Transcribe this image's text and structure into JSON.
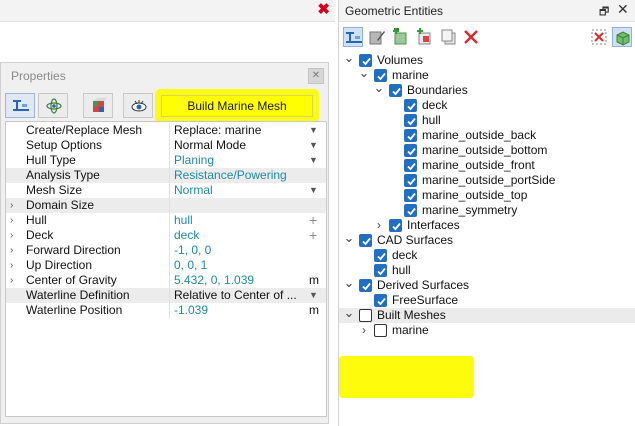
{
  "left_panel": {
    "close_glyph": "✖",
    "properties": {
      "title": "Properties",
      "close_glyph": "✕",
      "tabs": [
        {
          "name": "properties-tab-icon"
        },
        {
          "name": "physics-tab-icon"
        },
        {
          "name": "mesh-tab-icon"
        },
        {
          "name": "view-tab-icon"
        }
      ],
      "build_button_label": "Build Marine Mesh",
      "rows": [
        {
          "name": "Create/Replace Mesh",
          "value": "Replace: marine",
          "value_style": "dark",
          "suffix": "dropdown",
          "expandable": false
        },
        {
          "name": "Setup Options",
          "value": "Normal Mode",
          "value_style": "dark",
          "suffix": "dropdown",
          "expandable": false
        },
        {
          "name": "Hull Type",
          "value": "Planing",
          "value_style": "teal",
          "suffix": "dropdown",
          "expandable": false
        },
        {
          "name": "Analysis Type",
          "value": "Resistance/Powering",
          "value_style": "teal",
          "suffix": "",
          "expandable": false,
          "shaded": true
        },
        {
          "name": "Mesh Size",
          "value": "Normal",
          "value_style": "teal",
          "suffix": "dropdown",
          "expandable": false
        },
        {
          "name": "Domain Size",
          "value": "",
          "value_style": "teal",
          "suffix": "",
          "expandable": true,
          "shaded": true
        },
        {
          "name": "Hull",
          "value": "hull",
          "value_style": "teal",
          "suffix": "plus",
          "expandable": true
        },
        {
          "name": "Deck",
          "value": "deck",
          "value_style": "teal",
          "suffix": "plus",
          "expandable": true
        },
        {
          "name": "Forward Direction",
          "value": "-1, 0, 0",
          "value_style": "teal",
          "suffix": "",
          "expandable": true
        },
        {
          "name": "Up Direction",
          "value": "0, 0, 1",
          "value_style": "teal",
          "suffix": "",
          "expandable": true
        },
        {
          "name": "Center of Gravity",
          "value": "5.432, 0, 1.039",
          "value_style": "teal",
          "suffix": "unit",
          "unit": "m",
          "expandable": true
        },
        {
          "name": "Waterline Definition",
          "value": "Relative to Center of ...",
          "value_style": "dark",
          "suffix": "dropdown",
          "expandable": false,
          "shaded": true
        },
        {
          "name": "Waterline Position",
          "value": "-1.039",
          "value_style": "teal",
          "suffix": "unit",
          "unit": "m",
          "expandable": false
        }
      ]
    }
  },
  "right_panel": {
    "title": "Geometric Entities",
    "float_glyph": "🗗",
    "close_glyph": "✕",
    "toolbar": [
      {
        "name": "filter-tree-icon",
        "active": true
      },
      {
        "name": "edit-entity-icon",
        "active": false
      },
      {
        "name": "add-green-icon",
        "active": false
      },
      {
        "name": "add-red-icon",
        "active": false
      },
      {
        "name": "copy-entity-icon",
        "active": false
      },
      {
        "name": "delete-icon",
        "active": false
      },
      {
        "name": "deselect-icon",
        "active": false
      },
      {
        "name": "show-all-icon",
        "active": true
      }
    ],
    "tree": [
      {
        "label": "Volumes",
        "level": 0,
        "expander": "down",
        "checked": true
      },
      {
        "label": "marine",
        "level": 1,
        "expander": "down",
        "checked": true
      },
      {
        "label": "Boundaries",
        "level": 2,
        "expander": "down",
        "checked": true
      },
      {
        "label": "deck",
        "level": 3,
        "expander": "",
        "checked": true
      },
      {
        "label": "hull",
        "level": 3,
        "expander": "",
        "checked": true
      },
      {
        "label": "marine_outside_back",
        "level": 3,
        "expander": "",
        "checked": true
      },
      {
        "label": "marine_outside_bottom",
        "level": 3,
        "expander": "",
        "checked": true
      },
      {
        "label": "marine_outside_front",
        "level": 3,
        "expander": "",
        "checked": true
      },
      {
        "label": "marine_outside_portSide",
        "level": 3,
        "expander": "",
        "checked": true
      },
      {
        "label": "marine_outside_top",
        "level": 3,
        "expander": "",
        "checked": true
      },
      {
        "label": "marine_symmetry",
        "level": 3,
        "expander": "",
        "checked": true
      },
      {
        "label": "Interfaces",
        "level": 2,
        "expander": "right",
        "checked": true
      },
      {
        "label": "CAD Surfaces",
        "level": 0,
        "expander": "down",
        "checked": true
      },
      {
        "label": "deck",
        "level": 1,
        "expander": "",
        "checked": true
      },
      {
        "label": "hull",
        "level": 1,
        "expander": "",
        "checked": true
      },
      {
        "label": "Derived Surfaces",
        "level": 0,
        "expander": "down",
        "checked": true
      },
      {
        "label": "FreeSurface",
        "level": 1,
        "expander": "",
        "checked": true
      },
      {
        "label": "Built Meshes",
        "level": 0,
        "expander": "down",
        "checked": false,
        "highlight": true
      },
      {
        "label": "marine",
        "level": 1,
        "expander": "right",
        "checked": false
      }
    ]
  },
  "colors": {
    "highlight_yellow": "#fffb00",
    "checkbox_blue": "#1f6fc5",
    "value_teal": "#1e8aa6",
    "close_red": "#d0021b"
  }
}
